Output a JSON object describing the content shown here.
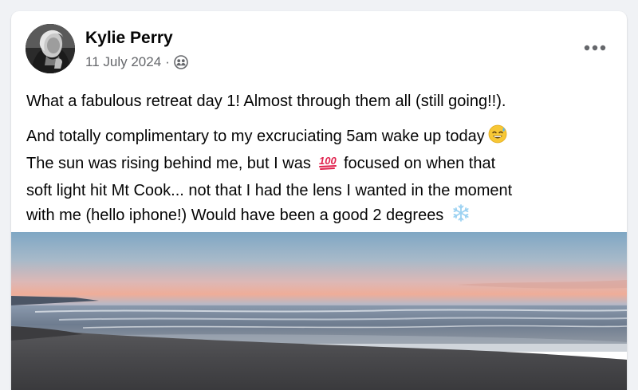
{
  "post": {
    "author_name": "Kylie Perry",
    "date": "11 July 2024",
    "separator": "·",
    "privacy_icon": "friends-icon",
    "more_icon": "more-options-icon",
    "paragraphs": [
      "What a fabulous retreat day 1! Almost through them all (still going!!).",
      "And totally complimentary to my excruciating 5am wake up today",
      "The sun was rising behind me, but I was",
      "focused on when that",
      "soft light hit Mt Cook... not that I had the lens I wanted in the moment",
      "with me (hello iphone!) Would have been a good 2 degrees"
    ],
    "emojis": {
      "sweat_smile": "sweat-smile-emoji",
      "hundred": "hundred-points-emoji",
      "snowflake": "snowflake-emoji"
    },
    "hundred_label": "100",
    "photo": "sunrise-beach-photo"
  }
}
